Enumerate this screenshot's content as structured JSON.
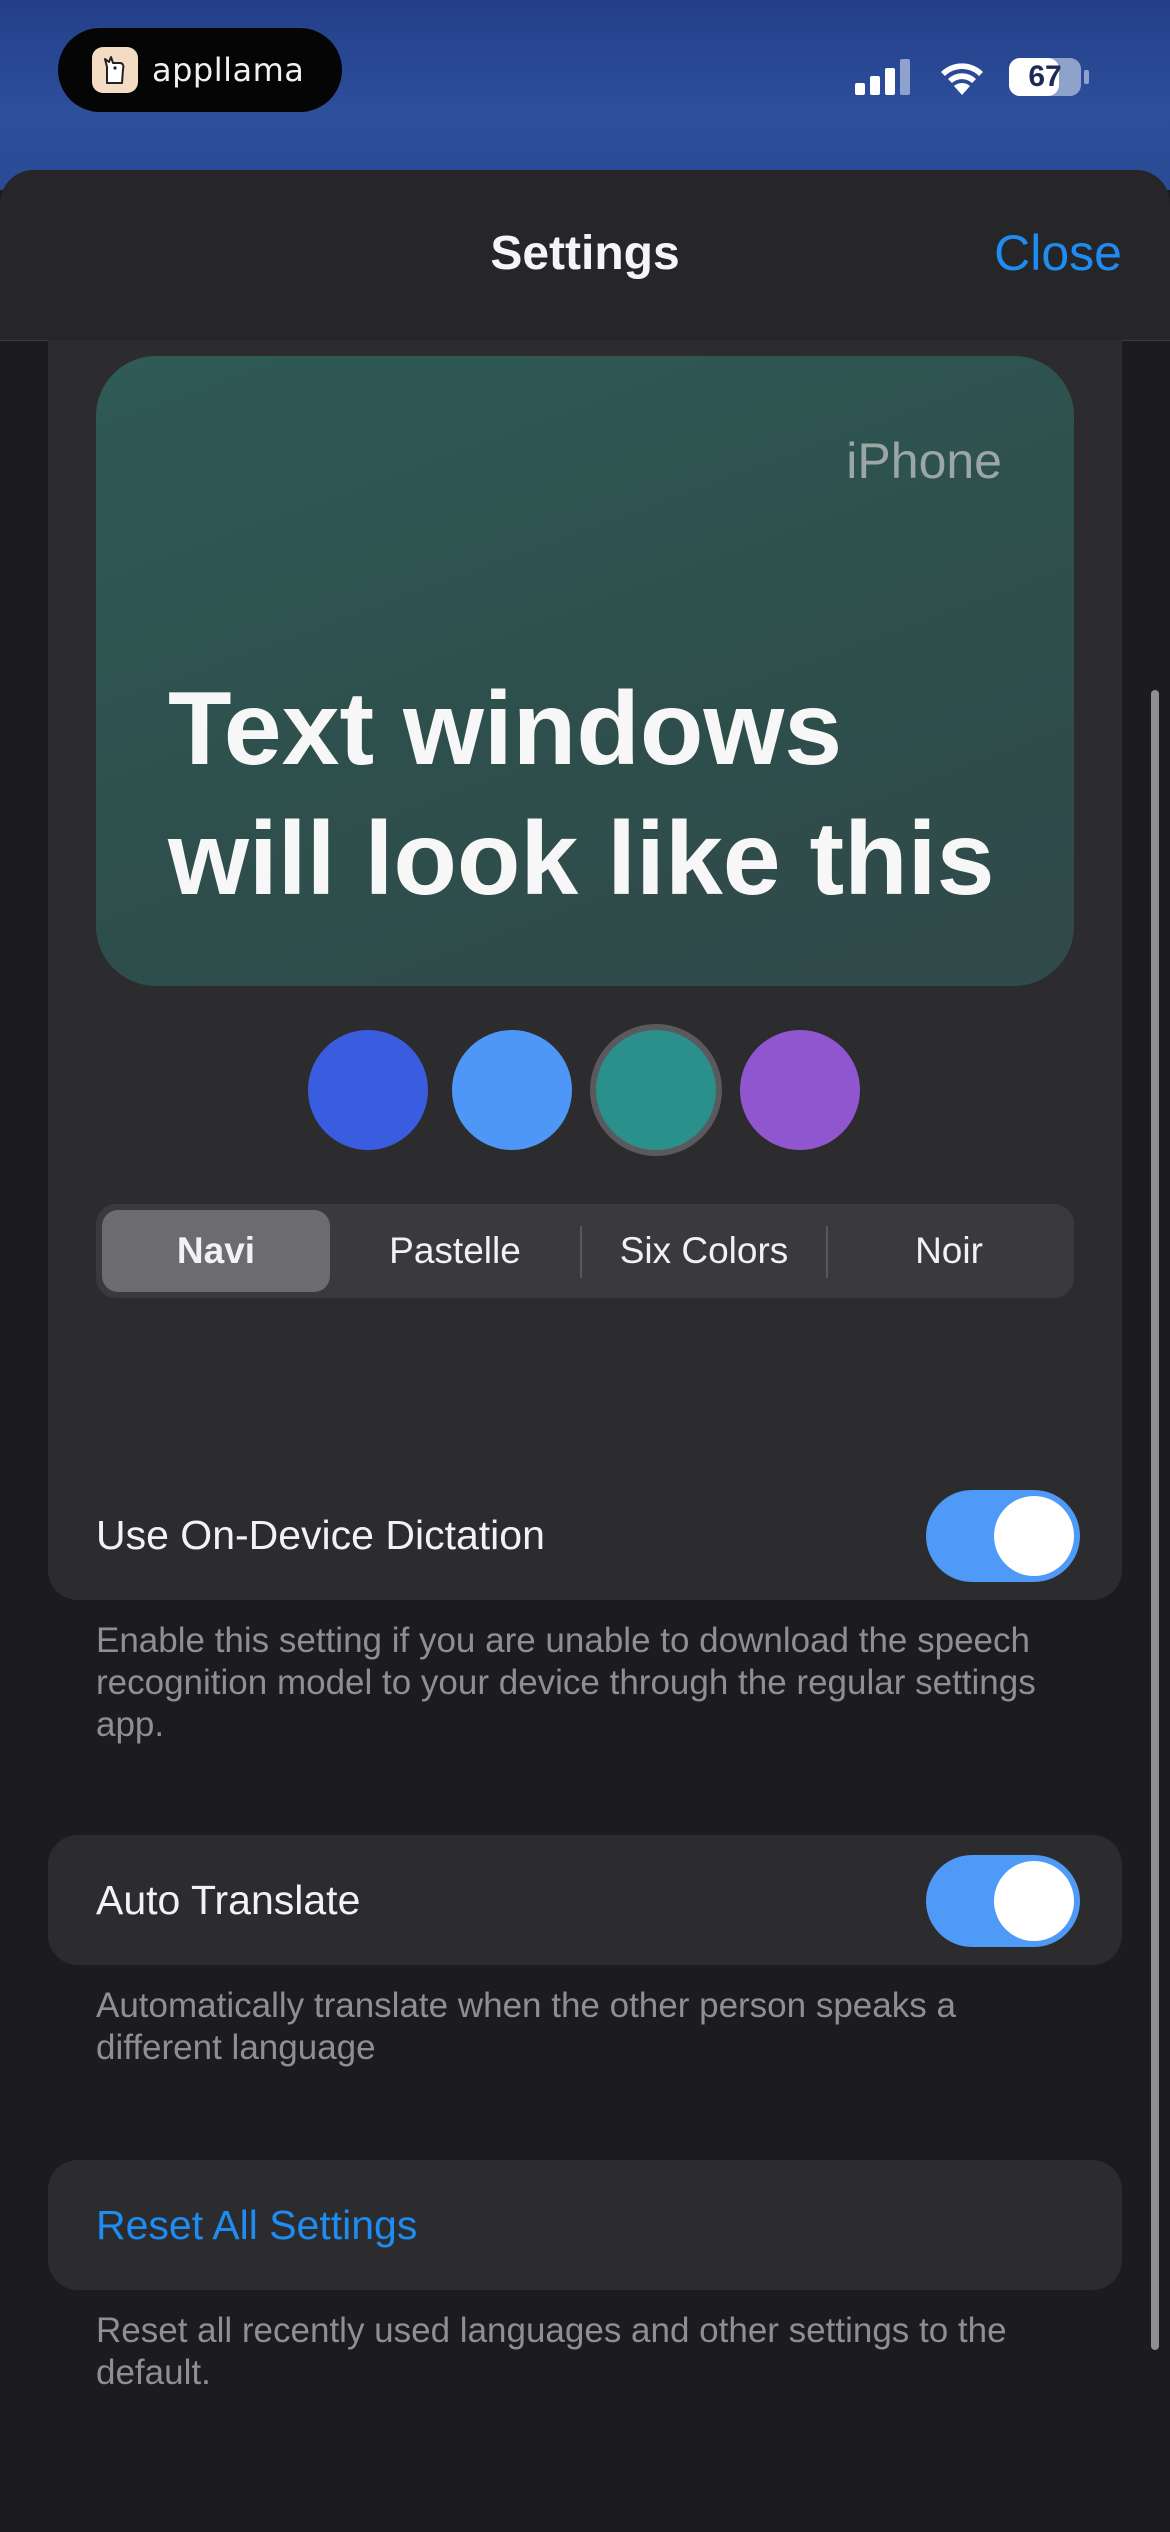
{
  "status_bar": {
    "app_name": "appllama",
    "battery_level": "67"
  },
  "nav": {
    "title": "Settings",
    "close_label": "Close"
  },
  "preview": {
    "device_label": "iPhone",
    "sample_text": "Text windows will look like this"
  },
  "swatches": [
    {
      "name": "royal-blue",
      "color": "#3a5de0"
    },
    {
      "name": "sky-blue",
      "color": "#4f97f7"
    },
    {
      "name": "teal",
      "color": "#2b8f8b",
      "selected": true
    },
    {
      "name": "purple",
      "color": "#9056d0"
    }
  ],
  "themes": {
    "options": [
      "Navi",
      "Pastelle",
      "Six Colors",
      "Noir"
    ],
    "selected": "Navi"
  },
  "dictation": {
    "label": "Use On-Device Dictation",
    "enabled": true,
    "footnote": "Enable this setting if you are unable to download the speech recognition model to your device through the regular settings app."
  },
  "auto_translate": {
    "label": "Auto Translate",
    "enabled": true,
    "footnote": "Automatically translate when the other person speaks a different language"
  },
  "reset": {
    "label": "Reset All Settings",
    "footnote": "Reset all recently used languages and other settings to the default."
  },
  "colors": {
    "accent": "#1e8cf0",
    "toggle_on": "#4f99f7"
  }
}
